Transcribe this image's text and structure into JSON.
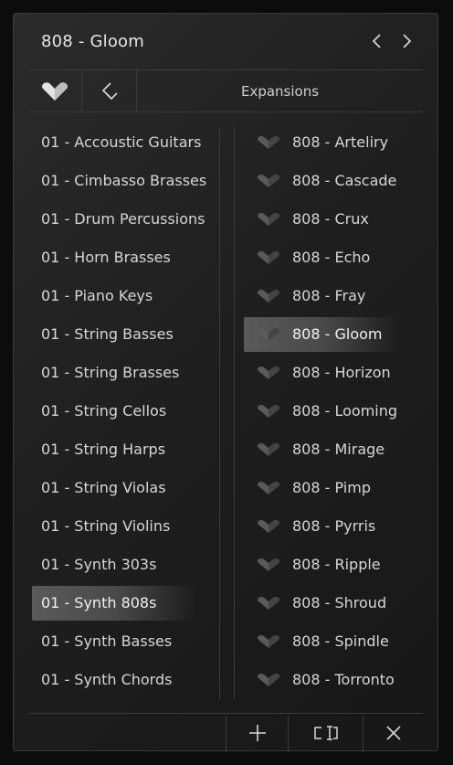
{
  "header": {
    "title": "808 - Gloom",
    "prev_icon": "chevron-left-icon",
    "next_icon": "chevron-right-icon"
  },
  "toolbar": {
    "favorites_icon": "heart-icon",
    "back_icon": "back-arrow-icon",
    "expansions_label": "Expansions"
  },
  "categories": {
    "selected": "01 - Synth 808s",
    "items": [
      "01 - Accoustic Guitars",
      "01 - Cimbasso Brasses",
      "01 - Drum Percussions",
      "01 - Horn Brasses",
      "01 - Piano Keys",
      "01 - String Basses",
      "01 - String Brasses",
      "01 - String Cellos",
      "01 - String Harps",
      "01 - String Violas",
      "01 - String Violins",
      "01 - Synth 303s",
      "01 - Synth 808s",
      "01 - Synth Basses",
      "01 - Synth Chords"
    ]
  },
  "presets": {
    "selected": "808 - Gloom",
    "favorite_icon": "heart-icon",
    "items": [
      "808 - Arteliry",
      "808 - Cascade",
      "808 - Crux",
      "808 - Echo",
      "808 - Fray",
      "808 - Gloom",
      "808 - Horizon",
      "808 - Looming",
      "808 - Mirage",
      "808 - Pimp",
      "808 - Pyrris",
      "808 - Ripple",
      "808 - Shroud",
      "808 - Spindle",
      "808 - Torronto"
    ]
  },
  "footer": {
    "add_icon": "plus-icon",
    "rename_icon": "rename-icon",
    "close_icon": "close-icon"
  },
  "colors": {
    "background": "#0c0c0c",
    "panel": "#222222",
    "divider": "#3a3a3a",
    "text": "#d6d6d6",
    "selection": "#555555"
  }
}
